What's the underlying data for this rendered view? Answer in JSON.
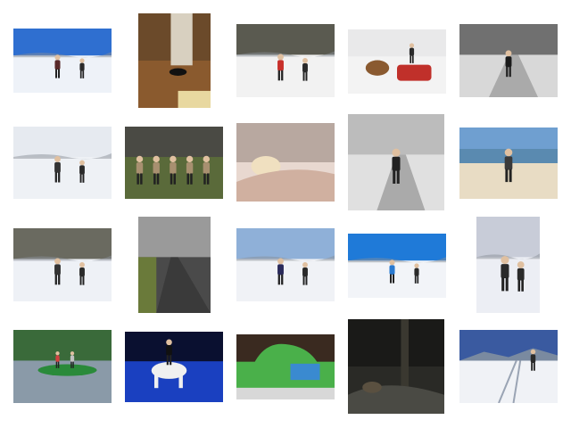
{
  "gallery": {
    "tiles": [
      {
        "id": "snowy-hikers-sun-photo",
        "sky": "#2f6fd0",
        "ground": "#eef2f8",
        "accent": "#5a2a2a",
        "kind": "snow-figures"
      },
      {
        "id": "cat-on-wood-floor-photo",
        "sky": "#6b4a2a",
        "ground": "#8a5a2e",
        "accent": "#e8d8a0",
        "kind": "interior"
      },
      {
        "id": "family-cross-country-skiing-photo",
        "sky": "#5a5a50",
        "ground": "#f2f2f2",
        "accent": "#c8302a",
        "kind": "snow-figures"
      },
      {
        "id": "horse-drawn-sleigh-photo",
        "sky": "#e9e9ea",
        "ground": "#f3f3f3",
        "accent": "#c0302a",
        "kind": "sleigh"
      },
      {
        "id": "bw-skier-on-trail-photo",
        "sky": "#707070",
        "ground": "#d8d8d8",
        "accent": "#1a1a1a",
        "kind": "bw"
      },
      {
        "id": "skiers-in-snowstorm-photo",
        "sky": "#e6eaf0",
        "ground": "#eef1f5",
        "accent": "#333333",
        "kind": "snow-figures"
      },
      {
        "id": "group-on-bench-landscape-photo",
        "sky": "#4a4a44",
        "ground": "#5a6a3a",
        "accent": "#a89070",
        "kind": "group"
      },
      {
        "id": "sleeping-child-in-bed-photo",
        "sky": "#b8a8a0",
        "ground": "#e8d8d0",
        "accent": "#d0b0a0",
        "kind": "bed"
      },
      {
        "id": "bw-person-on-bench-photo",
        "sky": "#bcbcbc",
        "ground": "#e0e0e0",
        "accent": "#222222",
        "kind": "bw"
      },
      {
        "id": "beach-walker-with-dogs-photo",
        "sky": "#6f9fd0",
        "ground": "#e8dcc4",
        "accent": "#3a3a3a",
        "kind": "beach"
      },
      {
        "id": "ski-tracks-near-forest-photo",
        "sky": "#6a6a60",
        "ground": "#eef1f6",
        "accent": "#333333",
        "kind": "snow-figures"
      },
      {
        "id": "road-to-horizon-photo",
        "sky": "#9a9a9a",
        "ground": "#4a4a4a",
        "accent": "#6a7a3a",
        "kind": "road"
      },
      {
        "id": "skiers-mountain-view-photo",
        "sky": "#8fb0d8",
        "ground": "#f0f2f6",
        "accent": "#2a2a5a",
        "kind": "snow-figures"
      },
      {
        "id": "skier-in-blue-sky-photo",
        "sky": "#1f7ad8",
        "ground": "#f2f4f8",
        "accent": "#2a7ad0",
        "kind": "snow-figures"
      },
      {
        "id": "skier-on-slope-trees-photo",
        "sky": "#c8ccd8",
        "ground": "#eceef4",
        "accent": "#2a2a2a",
        "kind": "snow-figures"
      },
      {
        "id": "green-rowboat-on-lake-photo",
        "sky": "#3a6a3a",
        "ground": "#8a9aa8",
        "accent": "#2a8a3a",
        "kind": "boat"
      },
      {
        "id": "horse-rider-show-arena-photo",
        "sky": "#0a1030",
        "ground": "#1a40c0",
        "accent": "#f0f0f0",
        "kind": "arena"
      },
      {
        "id": "green-birthday-cake-photo",
        "sky": "#3a2a20",
        "ground": "#4ab04a",
        "accent": "#3a8ad0",
        "kind": "cake"
      },
      {
        "id": "dark-room-figure-photo",
        "sky": "#1a1a18",
        "ground": "#2a2a26",
        "accent": "#5a5040",
        "kind": "dark"
      },
      {
        "id": "groomed-ski-track-photo",
        "sky": "#3a5aa0",
        "ground": "#f0f2f6",
        "accent": "#2a2a2a",
        "kind": "track"
      }
    ]
  }
}
